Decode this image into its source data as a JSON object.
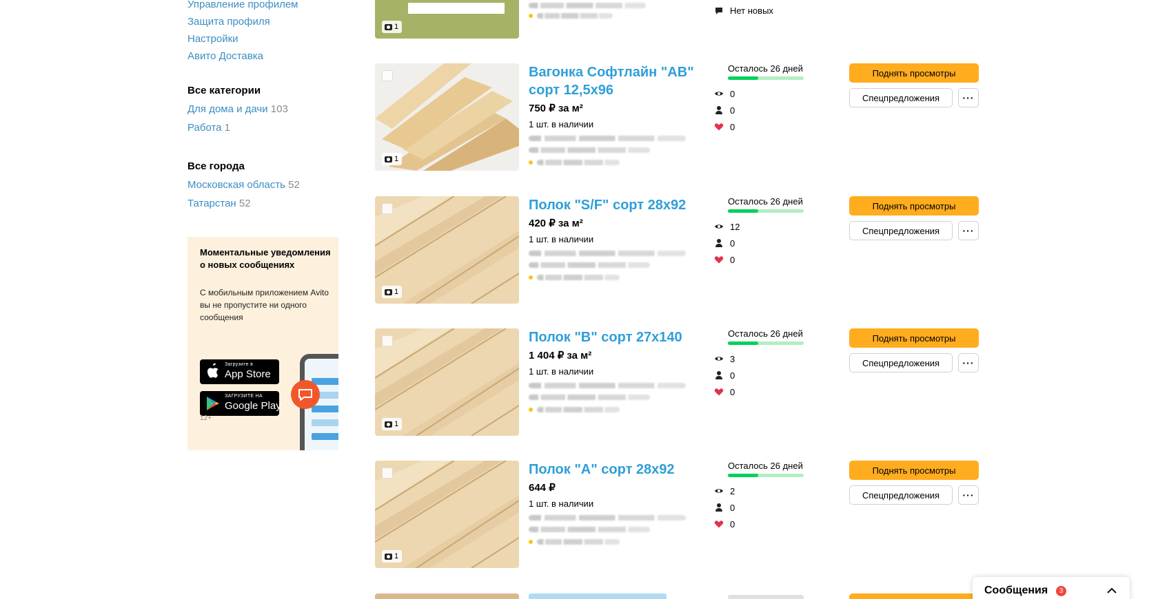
{
  "sidebar": {
    "profile_links": [
      "Управление профилем",
      "Защита профиля",
      "Настройки",
      "Авито Доставка"
    ],
    "categories": {
      "heading": "Все категории",
      "items": [
        {
          "label": "Для дома и дачи",
          "count": "103"
        },
        {
          "label": "Работа",
          "count": "1"
        }
      ]
    },
    "cities": {
      "heading": "Все города",
      "items": [
        {
          "label": "Московская область",
          "count": "52"
        },
        {
          "label": "Татарстан",
          "count": "52"
        }
      ]
    },
    "promo": {
      "title": "Моментальные уведомления о новых сообщениях",
      "text": "С мобильным приложением Avito вы не пропустите ни одного сообщения",
      "appstore_small": "Загрузите в",
      "appstore_big": "App Store",
      "googleplay_small": "ЗАГРУЗИТЕ НА",
      "googleplay_big": "Google Play",
      "age": "12+"
    }
  },
  "top_item": {
    "photo_count": "1",
    "messages_status": "Нет новых"
  },
  "listings": [
    {
      "title": "Вагонка Софтлайн \"AB\" сорт 12,5x96",
      "price": "750 ₽ за м²",
      "qty": "1 шт. в наличии",
      "days_left": "Осталось 26 дней",
      "days_fraction": 0.4,
      "views": "0",
      "contacts": "0",
      "favorites": "0",
      "photo_count": "1",
      "image": "boards"
    },
    {
      "title": "Полок \"S/F\" сорт 28x92",
      "price": "420 ₽ за м²",
      "qty": "1 шт. в наличии",
      "days_left": "Осталось 26 дней",
      "days_fraction": 0.4,
      "views": "12",
      "contacts": "0",
      "favorites": "0",
      "photo_count": "1",
      "image": "planks"
    },
    {
      "title": "Полок \"B\" сорт 27x140",
      "price": "1 404 ₽ за м²",
      "qty": "1 шт. в наличии",
      "days_left": "Осталось 26 дней",
      "days_fraction": 0.4,
      "views": "3",
      "contacts": "0",
      "favorites": "0",
      "photo_count": "1",
      "image": "planks"
    },
    {
      "title": "Полок \"A\" сорт 28x92",
      "price": "644 ₽",
      "qty": "1 шт. в наличии",
      "days_left": "Осталось 26 дней",
      "days_fraction": 0.4,
      "views": "2",
      "contacts": "0",
      "favorites": "0",
      "photo_count": "1",
      "image": "planks"
    }
  ],
  "buttons": {
    "raise": "Поднять просмотры",
    "special": "Спецпредложения",
    "more": "···"
  },
  "messages_bar": {
    "label": "Сообщения",
    "badge": "3"
  },
  "colors": {
    "link": "#3b8ec2",
    "title": "#2f9fd8",
    "raise_button": "#ffac1e",
    "progress": "#02d15c",
    "favorite": "#e0334d"
  }
}
